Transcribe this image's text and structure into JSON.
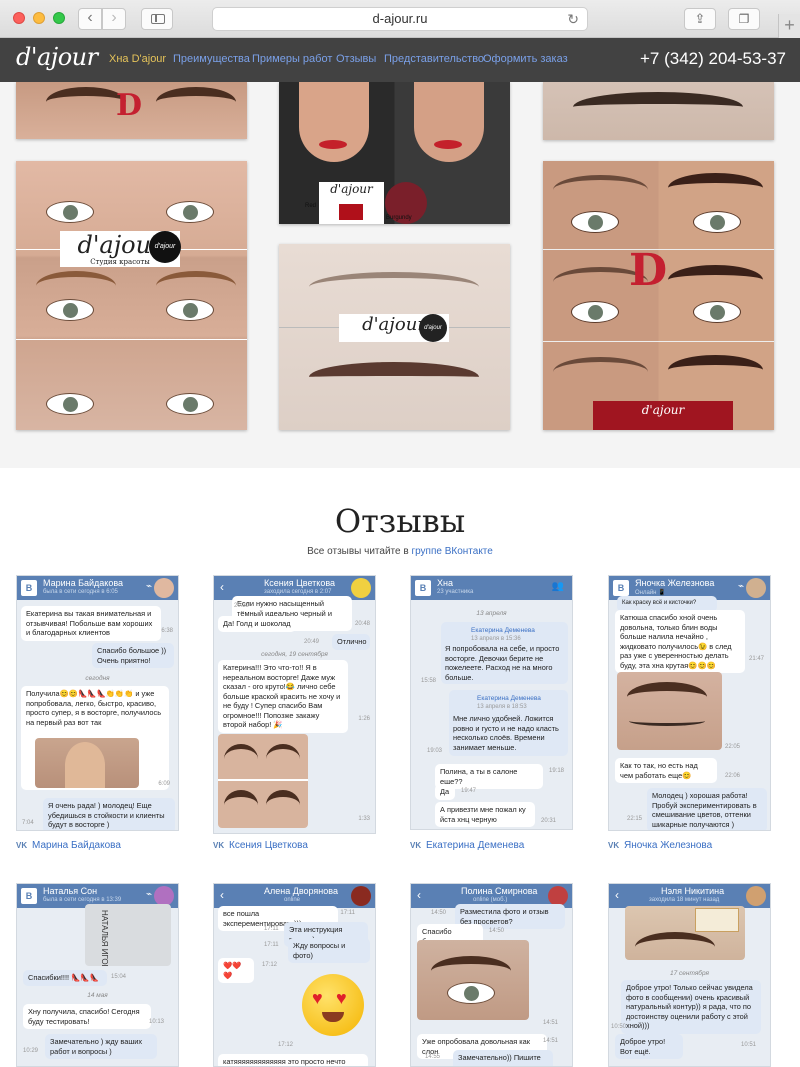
{
  "browser": {
    "url": "d-ajour.ru",
    "back_icon": "‹",
    "fwd_icon": "›",
    "reload_icon": "↻",
    "share_icon": "⇪",
    "tabs_icon": "❐",
    "newtab_icon": "+"
  },
  "header": {
    "logo": "d'ajour",
    "menu": [
      {
        "label": "Хна D'ajour",
        "active": true
      },
      {
        "label": "Преимущества"
      },
      {
        "label": "Примеры работ"
      },
      {
        "label": "Отзывы"
      },
      {
        "label": "Представительство"
      },
      {
        "label": "Оформить заказ"
      }
    ],
    "phone": "+7 (342) 204-53-37"
  },
  "gallery": {
    "badge_main": "d'ajour",
    "badge_tagline": "Студия красоты",
    "badge_small": "d'ajour",
    "d_mark": "D",
    "d_mark_sub": "D'AJOUR",
    "swatch_red": "Red",
    "swatch_burgundy": "Burgundy"
  },
  "reviews": {
    "title": "Отзывы",
    "subtitle_prefix": "Все отзывы читайте в",
    "subtitle_link": "группе ВКонтакте",
    "cards": [
      {
        "header_name": "Марина Байдакова",
        "header_status": "была в сети сегодня в 6:05",
        "author": "Марина Байдакова",
        "m1": "Екатерина вы такая внимательная и отзывчивая! Побольше вам хороших и благодарных клиентов",
        "t1": "6:38",
        "m2": "Спасибо большое )) Очень приятно!",
        "date": "сегодня",
        "m3": "Получила😊😊👠👠👠👏👏👏 и уже попробовала, легко, быстро, красиво, просто супер, я в восторге, получилось на первый раз вот так",
        "t3": "6:09",
        "m4": "Я очень рада! ) молодец! Еще убедишься в стойкости и клиенты будут в восторге )",
        "t4": "7:04"
      },
      {
        "header_name": "Ксения Цветкова",
        "header_status": "заходила сегодня в 2:07",
        "author": "Ксения Цветкова",
        "m0": "Если нужно насыщенный тёмный идеально черный и шоколад!",
        "t0": "20:39",
        "m1": "Да! Голд и шоколад",
        "t1": "20:48",
        "m2": "Отлично",
        "t2": "20:49",
        "date": "сегодня, 19 сентября",
        "m3": "Катерина!!! Это что-то!! Я в нереальном восторге! Даже муж сказал - ого круто!😂 лично себе больше краской красить не хочу и не буду ! Супер спасибо Вам огромное!!! Попозже закажу второй набор! 🎉",
        "t3": "1:26",
        "t4": "1:33"
      },
      {
        "header_name": "Хна",
        "header_status": "23 участника",
        "author": "Екатерина Деменева",
        "date": "13 апреля",
        "q1_name": "Екатерина Деменева",
        "q1_time": "13 апреля в 15:36",
        "m1": "Я попробовала на себе, и просто восторге. Девочки берите не пожелеете. Расход не на много больше.",
        "t1": "15:58",
        "q2_name": "Екатерина Деменева",
        "q2_time": "13 апреля в 18:53",
        "m2": "Мне лично удобней. Ложится ровно и густо и не надо класть несколько слоёв. Времени занимает меньше.",
        "t2": "19:03",
        "m3": "Полина, а ты в салоне еще??",
        "t3": "19:18",
        "m4": "Да",
        "t4": "19:47",
        "m5": "А привезти мне пожал ку йста хнц черную",
        "t5": "20:31"
      },
      {
        "header_name": "Яночка Железнова",
        "header_status": "Онлайн 📱",
        "author": "Яночка Железнова",
        "m0": "Как краску всё и кисточки?",
        "m1": "Катюша спасибо хной очень довольна, только блин воды больше налила нечайно , жидковато получилось😉 в след раз уже с уверенностью делать буду, эта хна крутая😊😊😊",
        "t1": "21:47",
        "t2": "22:05",
        "m3": "Как то так, но есть над чем работать еще😊",
        "t3": "22:06",
        "m4": "Молодец ) хорошая работа! Пробуй экспериментировать в смешивание цветов, оттенки шикарные получаются )",
        "t4": "22:15"
      },
      {
        "header_name": "Наталья Сон",
        "header_status": "была в сети сегодня в 13:39",
        "m1": "Спасибки!!!! 👠👠👠",
        "t1": "15:04",
        "date": "14 мая",
        "m2": "Хну получила, спасибо! Сегодня буду тестировать!",
        "t2": "10:13",
        "m3": "Замечательно ) жду ваших работ и вопросы )",
        "t3": "10:29",
        "label1": "НАТАЛЬЯ ИГОРЕВНА"
      },
      {
        "header_name": "Алена Дворянова",
        "header_status": "online",
        "m1": "все пошла эксперементировать)))",
        "t1": "17:11",
        "m2": "Эта инструкция внутри)",
        "t2": "17:11",
        "m3": "Жду вопросы и фото)",
        "t3": "17:11",
        "m4": "❤️❤️❤️",
        "t4": "17:12",
        "t5": "17:12",
        "m6": "катяяяяяяяяяяяяя это просто нечто"
      },
      {
        "header_name": "Полина Смирнова",
        "header_status": "online (моб.)",
        "m0": "Разместила фото и отзыв без просветов?",
        "t0": "14:50",
        "m1": "Спасибо большое",
        "t1": "14:50",
        "t2": "14:51",
        "m3": "Уже опробовала довольная как слон",
        "t3": "14:51",
        "m4": "Замечательно)) Пишите если",
        "t4": "14:55"
      },
      {
        "header_name": "Нэля Никитина",
        "header_status": "заходила 18 минут назад",
        "date": "17 сентября",
        "m1": "Доброе утро! Только сейчас увидела фото в сообщении) очень красивый натуральный контур)) я рада, что по достоинству оценили работу с этой хной)))",
        "t1": "10:50",
        "m2": "Доброе утро! Вот ещё.",
        "t2": "10:51"
      }
    ]
  },
  "colors": {
    "header_bg": "#323232",
    "menu_link": "#7aa0e8",
    "menu_active": "#e5c35a",
    "vk_blue": "#5a80b4",
    "link_blue": "#3a6fc4"
  }
}
